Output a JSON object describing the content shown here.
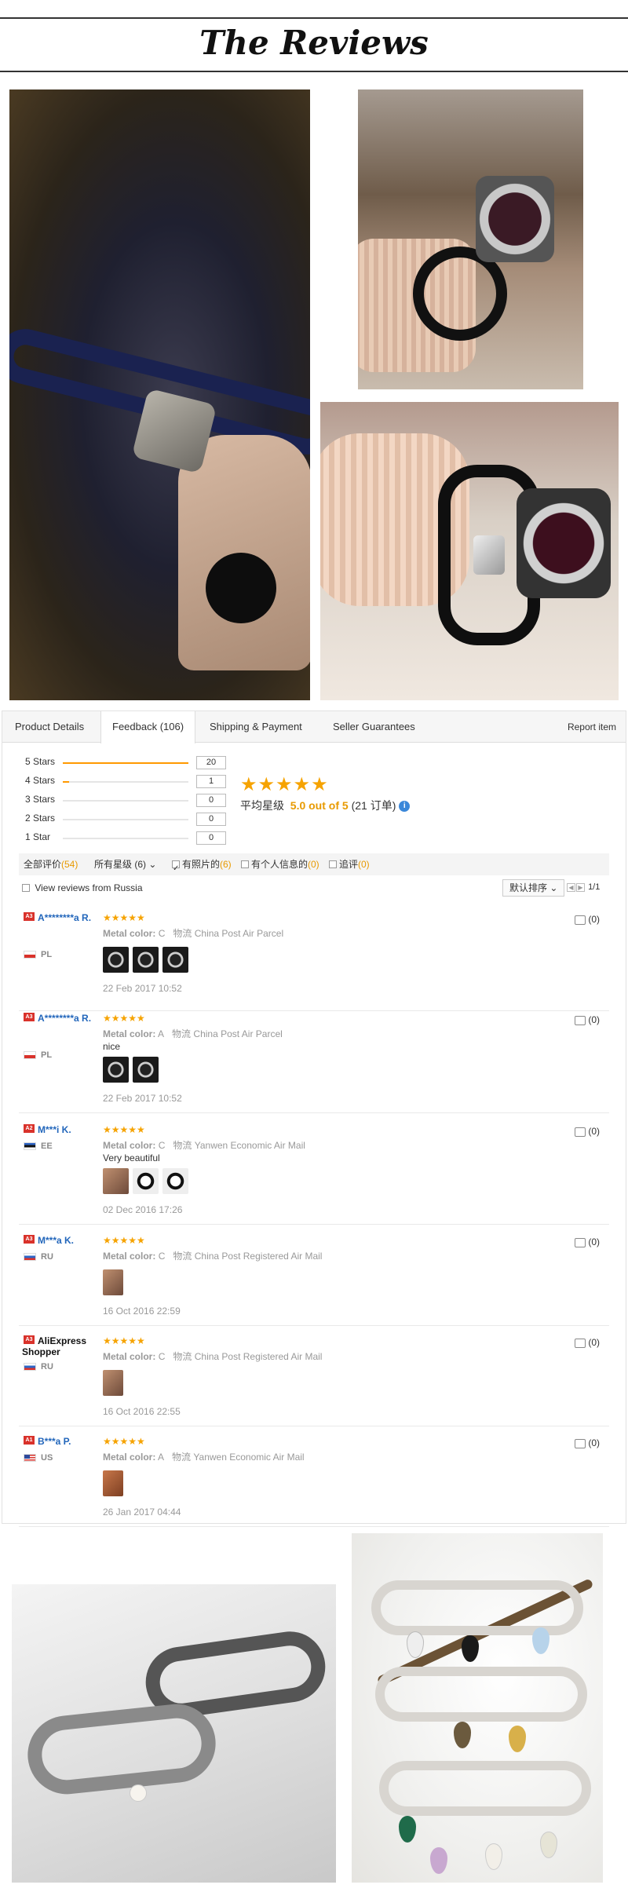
{
  "header": {
    "title": "The Reviews"
  },
  "tabs": [
    {
      "label": "Product Details"
    },
    {
      "label": "Feedback (106)"
    },
    {
      "label": "Shipping & Payment"
    },
    {
      "label": "Seller Guarantees"
    }
  ],
  "report_label": "Report item",
  "distribution": [
    {
      "label": "5 Stars",
      "count": "20",
      "fill": 1.0
    },
    {
      "label": "4 Stars",
      "count": "1",
      "fill": 0.05
    },
    {
      "label": "3 Stars",
      "count": "0",
      "fill": 0
    },
    {
      "label": "2 Stars",
      "count": "0",
      "fill": 0
    },
    {
      "label": "1 Star",
      "count": "0",
      "fill": 0
    }
  ],
  "summary": {
    "stars": "★★★★★",
    "avg_label": "平均星级",
    "score": "5.0 out of 5",
    "orders": "(21 订单)",
    "info_icon": "i"
  },
  "filters": {
    "all_label": "全部评价",
    "all_count": "(54)",
    "stars_label": "所有星级 (6)",
    "photo_label": "有照片的",
    "photo_count": "(6)",
    "personal_label": "有个人信息的",
    "personal_count": "(0)",
    "followup_label": "追评",
    "followup_count": "(0)"
  },
  "russia_label": "View reviews from Russia",
  "sort_label": "默认排序",
  "pager": "1/1",
  "reviews": [
    {
      "badge": "A3",
      "name": "A********a R.",
      "country": "PL",
      "flag": "pl",
      "stars": "★★★★★",
      "color_label": "Metal color:",
      "color": "C",
      "ship_label": "物流",
      "ship": "China Post Air Parcel",
      "text": "",
      "date": "22 Feb 2017 10:52",
      "useful": "(0)"
    },
    {
      "badge": "A3",
      "name": "A********a R.",
      "country": "PL",
      "flag": "pl",
      "stars": "★★★★★",
      "color_label": "Metal color:",
      "color": "A",
      "ship_label": "物流",
      "ship": "China Post Air Parcel",
      "text": "nice",
      "date": "22 Feb 2017 10:52",
      "useful": "(0)"
    },
    {
      "badge": "A2",
      "name": "M***i K.",
      "country": "EE",
      "flag": "ee",
      "stars": "★★★★★",
      "color_label": "Metal color:",
      "color": "C",
      "ship_label": "物流",
      "ship": "Yanwen Economic Air Mail",
      "text": "Very beautiful",
      "date": "02 Dec 2016 17:26",
      "useful": "(0)"
    },
    {
      "badge": "A3",
      "name": "M***a K.",
      "country": "RU",
      "flag": "ru",
      "stars": "★★★★★",
      "color_label": "Metal color:",
      "color": "C",
      "ship_label": "物流",
      "ship": "China Post Registered Air Mail",
      "text": "",
      "date": "16 Oct 2016 22:59",
      "useful": "(0)"
    },
    {
      "badge": "A3",
      "name": "AliExpress Shopper",
      "country": "RU",
      "flag": "ru",
      "stars": "★★★★★",
      "color_label": "Metal color:",
      "color": "C",
      "ship_label": "物流",
      "ship": "China Post Registered Air Mail",
      "text": "",
      "date": "16 Oct 2016 22:55",
      "useful": "(0)"
    },
    {
      "badge": "A1",
      "name": "B***a P.",
      "country": "US",
      "flag": "us",
      "stars": "★★★★★",
      "color_label": "Metal color:",
      "color": "A",
      "ship_label": "物流",
      "ship": "Yanwen Economic Air Mail",
      "text": "",
      "date": "26 Jan 2017 04:44",
      "useful": "(0)"
    }
  ],
  "colors": {
    "accent": "#f6a300",
    "link": "#2266bb",
    "badge": "#d9322b"
  }
}
